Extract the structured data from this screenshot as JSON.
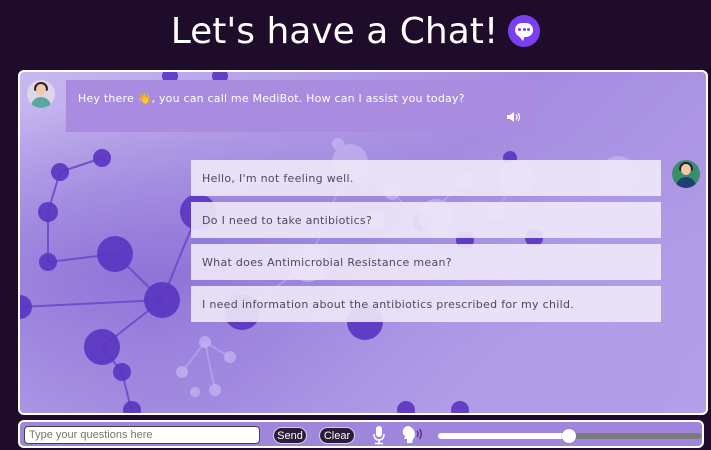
{
  "header": {
    "title": "Let's have a Chat!",
    "icon": "chat-bubble-icon",
    "accent": "#7b3ff2"
  },
  "chat": {
    "bot_message": {
      "text_before": "Hey there ",
      "emoji": "👋",
      "text_after": ", you can call me MediBot. How can I assist you today?"
    },
    "user_messages": [
      "Hello, I'm not feeling well.",
      "Do I need to take antibiotics?",
      "What does Antimicrobial Resistance mean?",
      "I need information about the antibiotics prescribed for my child."
    ]
  },
  "input_bar": {
    "placeholder": "Type your questions here",
    "send_label": "Send",
    "clear_label": "Clear",
    "slider_value": 0.5
  },
  "colors": {
    "background": "#1f0c2b",
    "bot_bubble": "#a98ce0",
    "user_bubble": "#eee9f8"
  }
}
